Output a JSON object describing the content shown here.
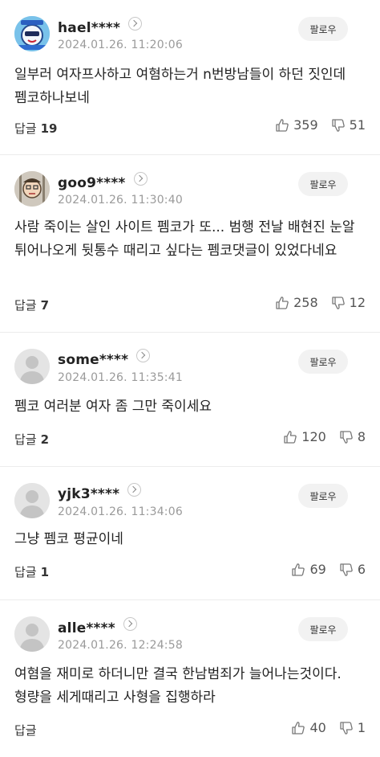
{
  "follow_label": "팔로우",
  "reply_label": "답글",
  "comments": [
    {
      "username": "hael****",
      "date": "2024.01.26. 11:20:06",
      "body": "일부러 여자프사하고 여혐하는거 n번방남들이 하던 짓인데 펨코하나보네",
      "replies": "19",
      "likes": "359",
      "dislikes": "51",
      "avatar": "avatar-cartoon"
    },
    {
      "username": "goo9****",
      "date": "2024.01.26. 11:30:40",
      "body": "사람 죽이는 살인 사이트 펨코가 또... 범행 전날 배현진 눈알 튀어나오게 뒷통수 때리고 싶다는 펨코댓글이 있었다네요",
      "replies": "7",
      "likes": "258",
      "dislikes": "12",
      "avatar": "avatar-illustration"
    },
    {
      "username": "some****",
      "date": "2024.01.26. 11:35:41",
      "body": "펨코 여러분 여자 좀 그만 죽이세요",
      "replies": "2",
      "likes": "120",
      "dislikes": "8",
      "avatar": "avatar-default"
    },
    {
      "username": "yjk3****",
      "date": "2024.01.26. 11:34:06",
      "body": "그냥 펨코 평균이네",
      "replies": "1",
      "likes": "69",
      "dislikes": "6",
      "avatar": "avatar-default"
    },
    {
      "username": "alle****",
      "date": "2024.01.26. 12:24:58",
      "body": "여혐을 재미로 하더니만 결국 한남범죄가 늘어나는것이다. 형량을 세게때리고 사형을 집행하라",
      "replies": "",
      "likes": "40",
      "dislikes": "1",
      "avatar": "avatar-default"
    }
  ]
}
